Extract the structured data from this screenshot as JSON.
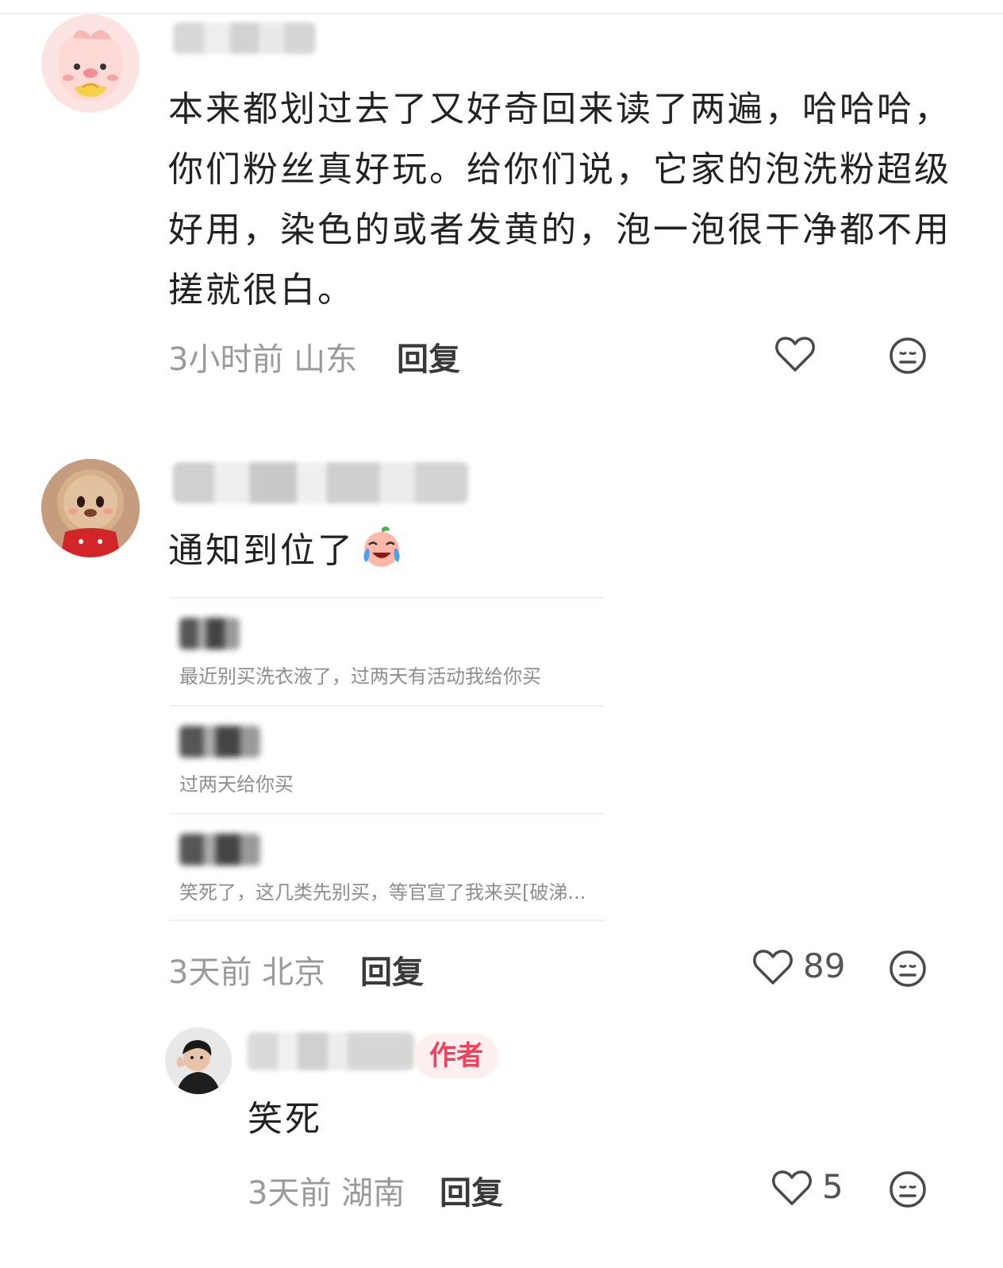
{
  "comments": [
    {
      "text": "本来都划过去了又好奇回来读了两遍，哈哈哈，你们粉丝真好玩。给你们说，它家的泡洗粉超级好用，染色的或者发黄的，泡一泡很干净都不用搓就很白。",
      "time_location": "3小时前 山东",
      "reply_label": "回复",
      "like_count": ""
    },
    {
      "text": "通知到位了",
      "emoji": "crying-laughing-peach-emoji",
      "time_location": "3天前 北京",
      "reply_label": "回复",
      "like_count": "89",
      "quoted": [
        {
          "text": "最近别买洗衣液了，过两天有活动我给你买"
        },
        {
          "text": "过两天给你买"
        },
        {
          "text": "笑死了，这几类先别买，等官宣了我来买[破涕..."
        }
      ]
    },
    {
      "text": "笑死",
      "author_badge": "作者",
      "time_location": "3天前 湖南",
      "reply_label": "回复",
      "like_count": "5"
    }
  ],
  "icons": {
    "like": "heart-outline-icon",
    "dislike": "neutral-face-icon"
  },
  "colors": {
    "author_badge_text": "#f0425d",
    "author_badge_bg": "#fdeef0",
    "meta_gray": "#9a9a9a"
  }
}
